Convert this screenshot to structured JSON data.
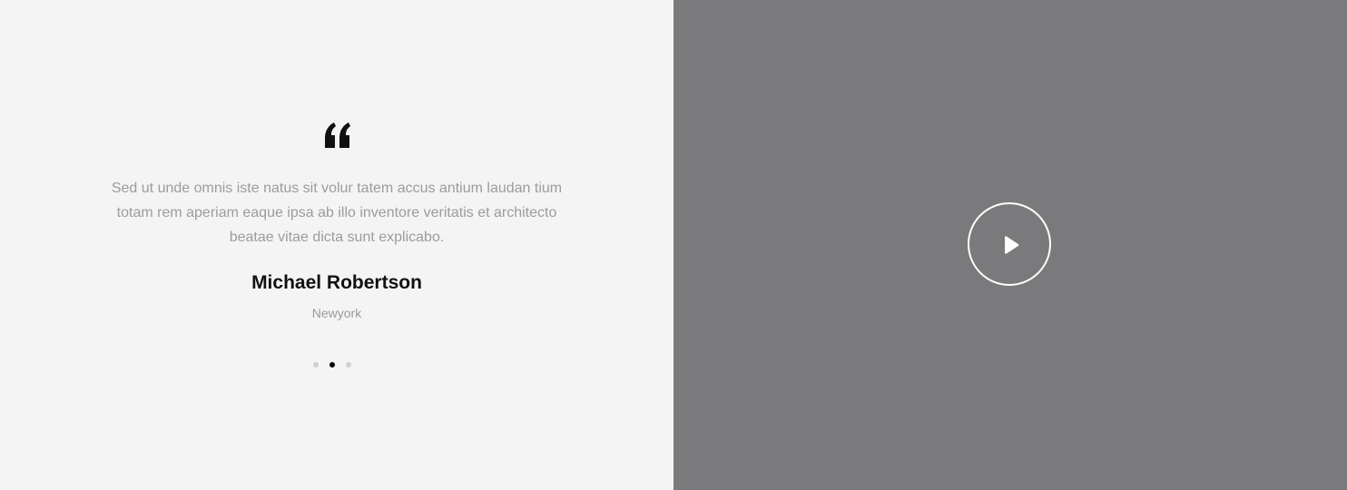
{
  "testimonial": {
    "quote_icon": "quote-open-icon",
    "text": "Sed ut unde omnis iste natus sit volur tatem accus antium laudan tium totam rem aperiam eaque ipsa ab illo inventore veritatis et architecto beatae vitae dicta sunt explicabo.",
    "author_name": "Michael Robertson",
    "author_location": "Newyork",
    "pagination": {
      "count": 3,
      "active_index": 1
    }
  },
  "video": {
    "play_icon": "play-icon"
  },
  "colors": {
    "left_background": "#f4f4f4",
    "right_background": "#7a7a7c",
    "quote_text": "#9c9c9c",
    "author_name": "#111111",
    "author_location": "#9a9a9a",
    "dot_inactive": "#cfcfcf",
    "dot_active": "#000000",
    "play_button": "#ffffff"
  }
}
